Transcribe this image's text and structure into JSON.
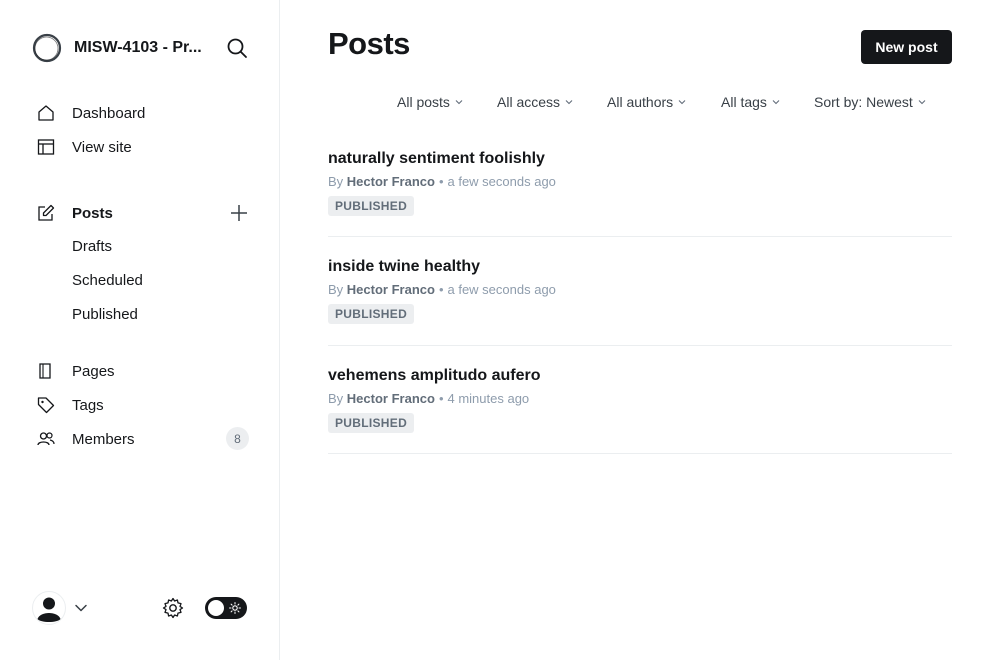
{
  "brand": {
    "title": "MISW-4103 - Pr..."
  },
  "sidebar": {
    "primary": [
      {
        "label": "Dashboard",
        "icon": "home-icon"
      },
      {
        "label": "View site",
        "icon": "layout-icon"
      }
    ],
    "posts": {
      "label": "Posts",
      "icon": "edit-icon",
      "sub": [
        "Drafts",
        "Scheduled",
        "Published"
      ]
    },
    "secondary": [
      {
        "label": "Pages",
        "icon": "page-icon"
      },
      {
        "label": "Tags",
        "icon": "tag-icon"
      },
      {
        "label": "Members",
        "icon": "members-icon",
        "count": "8"
      }
    ]
  },
  "header": {
    "title": "Posts",
    "new_post_label": "New post"
  },
  "filters": [
    "All posts",
    "All access",
    "All authors",
    "All tags",
    "Sort by: Newest"
  ],
  "posts": [
    {
      "title": "naturally sentiment foolishly",
      "by": "By",
      "author": "Hector Franco",
      "time": "a few seconds ago",
      "status": "PUBLISHED"
    },
    {
      "title": "inside twine healthy",
      "by": "By",
      "author": "Hector Franco",
      "time": "a few seconds ago",
      "status": "PUBLISHED"
    },
    {
      "title": "vehemens amplitudo aufero",
      "by": "By",
      "author": "Hector Franco",
      "time": "4 minutes ago",
      "status": "PUBLISHED"
    }
  ],
  "colors": {
    "accent": "#15171a",
    "badge_bg": "#eceef0",
    "muted": "#8e9cac",
    "border": "#ebeef0"
  }
}
